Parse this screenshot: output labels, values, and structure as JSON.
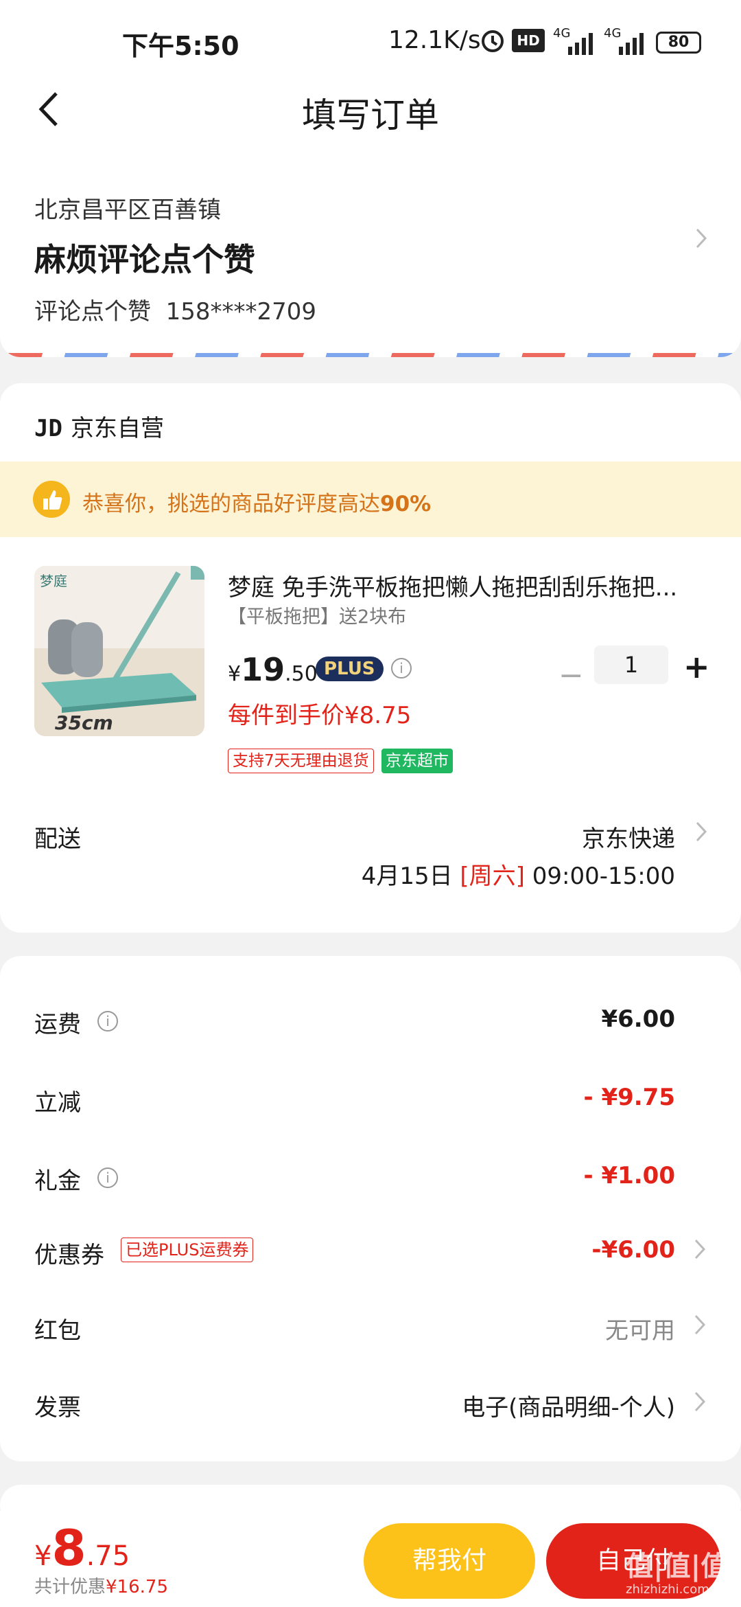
{
  "status_bar": {
    "time": "下午5:50",
    "speed": "12.1K/s",
    "hd": "HD",
    "net1": "4G",
    "net2": "4G",
    "battery": "80"
  },
  "header": {
    "title": "填写订单"
  },
  "address": {
    "region": "北京昌平区百善镇",
    "detail": "麻烦评论点个赞",
    "name": "评论点个赞",
    "phone": "158****2709"
  },
  "shop": {
    "logo": "JD",
    "name": "京东自营"
  },
  "banner": {
    "text": "恭喜你，挑选的商品好评度高达",
    "percent": "90%"
  },
  "product": {
    "image_label": "梦庭",
    "image_size_text": "35cm",
    "name": "梦庭 免手洗平板拖把懒人拖把刮刮乐拖把...",
    "spec": "【平板拖把】送2块布",
    "price_symbol": "¥",
    "price_int": "19",
    "price_dec": ".50",
    "plus_badge": "PLUS",
    "per_price": "每件到手价¥8.75",
    "quantity": "1",
    "minus": "−",
    "plus": "+",
    "tags": [
      "支持7天无理由退货",
      "京东超市"
    ]
  },
  "shipping": {
    "label": "配送",
    "method": "京东快递",
    "date": "4月15日",
    "weekday": "[周六]",
    "time": "09:00-15:00"
  },
  "costs": [
    {
      "label": "运费",
      "value": "¥6.00"
    },
    {
      "label": "立减",
      "value": "- ¥9.75"
    },
    {
      "label": "礼金",
      "value": "- ¥1.00"
    },
    {
      "label": "优惠券",
      "tag": "已选PLUS运费券",
      "value": "-¥6.00"
    },
    {
      "label": "红包",
      "value": "无可用"
    },
    {
      "label": "发票",
      "value": "电子(商品明细-个人)"
    }
  ],
  "footer": {
    "currency": "¥",
    "total_int": "8",
    "total_dec": ".75",
    "saved_label": "共计优惠",
    "saved_value": "¥16.75",
    "help_pay": "帮我付",
    "self_pay": "自己付",
    "watermark": "值|值|值",
    "watermark_url": "zhizhizhi.com"
  },
  "colors": {
    "accent": "#e2231a",
    "yellow": "#fcc21a",
    "banner_bg": "#fdf4d6"
  }
}
